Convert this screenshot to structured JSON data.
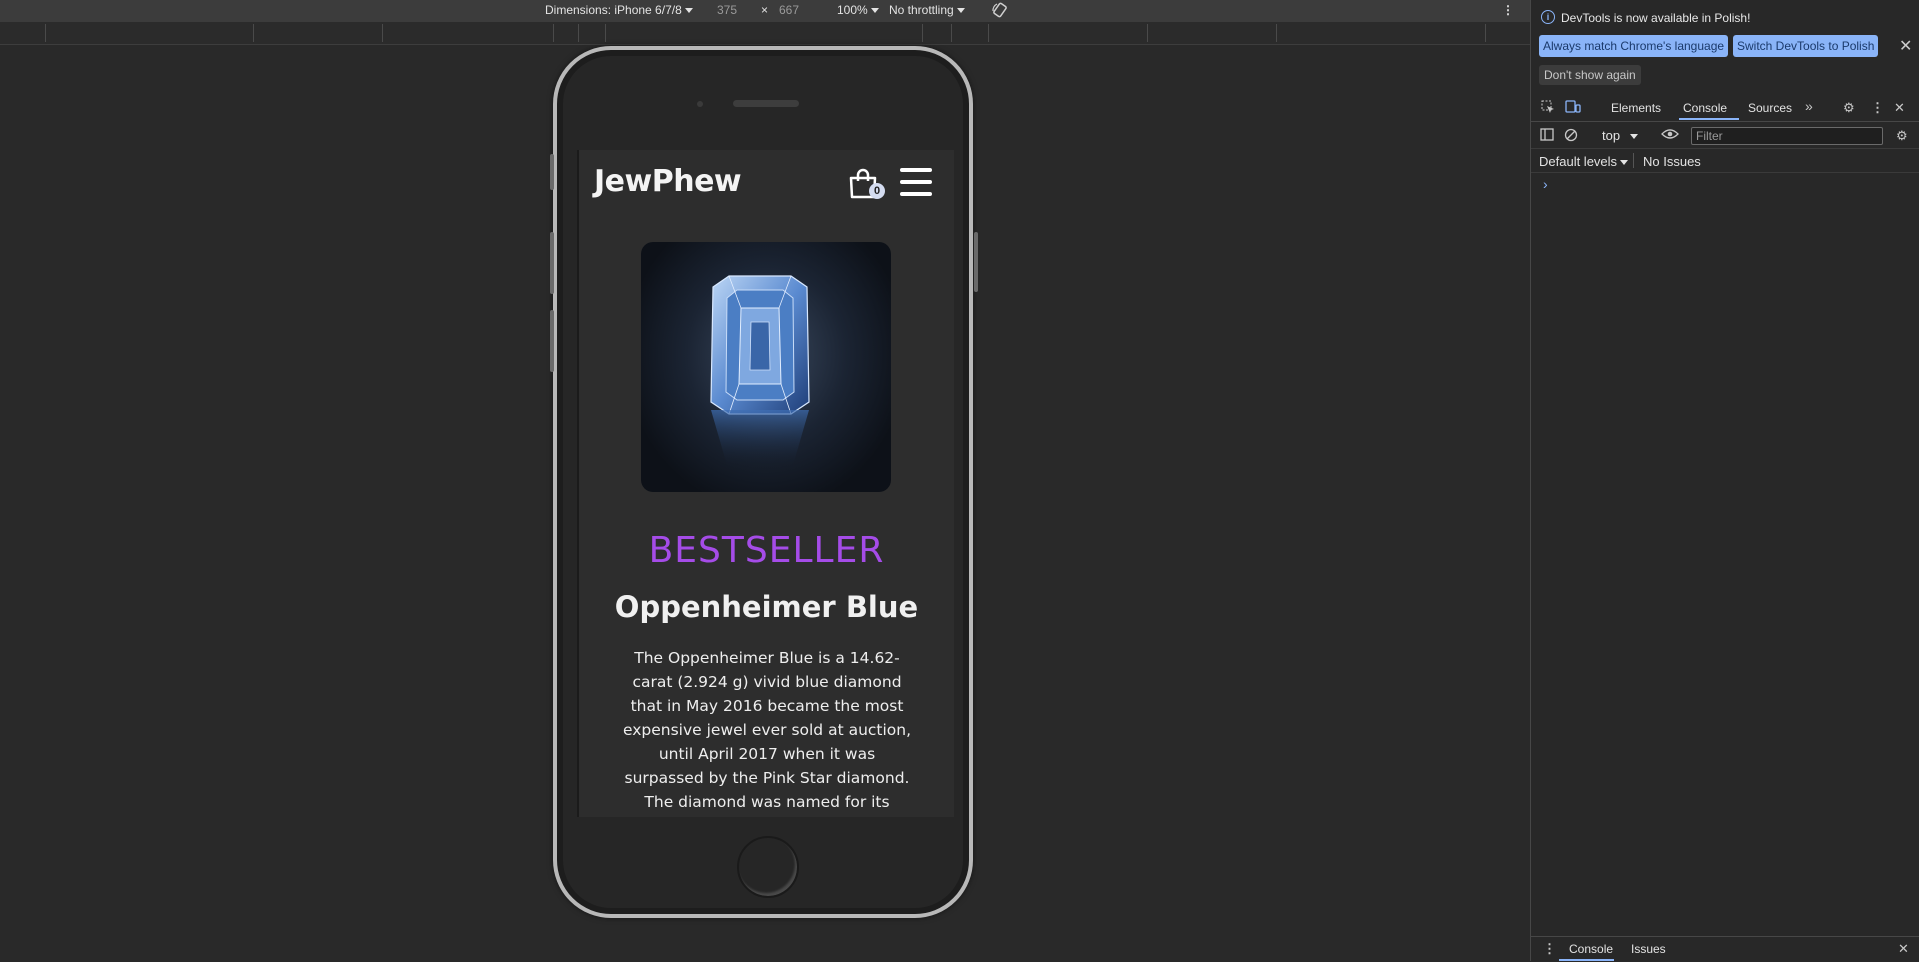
{
  "device_toolbar": {
    "dimensions_label": "Dimensions: iPhone 6/7/8",
    "width": "375",
    "times": "×",
    "height": "667",
    "zoom": "100%",
    "throttling": "No throttling"
  },
  "site": {
    "brand": "JewPhew",
    "cart_count": "0",
    "badge": "BESTSELLER",
    "product_name": "Oppenheimer Blue",
    "product_description": "The Oppenheimer Blue is a 14.62-carat (2.924 g) vivid blue diamond that in May 2016 became the most expensive jewel ever sold at auction, until April 2017 when it was surpassed by the Pink Star diamond. The diamond was named for its previous owner Philip Oppenheimer.It is"
  },
  "devtools": {
    "info_text": "DevTools is now available in Polish!",
    "match_language_button": "Always match Chrome's language",
    "switch_language_button": "Switch DevTools to Polish",
    "dont_show_button": "Don't show again",
    "tabs": [
      "Elements",
      "Console",
      "Sources"
    ],
    "context": "top",
    "filter_placeholder": "Filter",
    "levels": "Default levels",
    "issues": "No Issues",
    "drawer_tabs": [
      "Console",
      "Issues"
    ]
  },
  "colors": {
    "badge": "#a54ce8",
    "accent": "#8ab4f8"
  }
}
